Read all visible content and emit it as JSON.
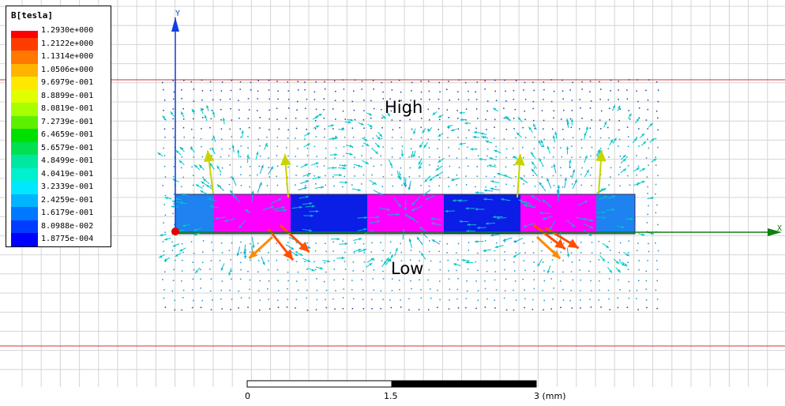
{
  "legend": {
    "title": "B[tesla]",
    "entries": [
      {
        "label": "1.2930e+000",
        "color": "#ff0000"
      },
      {
        "label": "1.2122e+000",
        "color": "#ff3c00"
      },
      {
        "label": "1.1314e+000",
        "color": "#ff7800"
      },
      {
        "label": "1.0506e+000",
        "color": "#ffb400"
      },
      {
        "label": "9.6979e-001",
        "color": "#ffe800"
      },
      {
        "label": "8.8899e-001",
        "color": "#e0ff00"
      },
      {
        "label": "8.0819e-001",
        "color": "#a8ff00"
      },
      {
        "label": "7.2739e-001",
        "color": "#5cf000"
      },
      {
        "label": "6.4659e-001",
        "color": "#00e000"
      },
      {
        "label": "5.6579e-001",
        "color": "#00e050"
      },
      {
        "label": "4.8499e-001",
        "color": "#00e8a0"
      },
      {
        "label": "4.0419e-001",
        "color": "#00f0d0"
      },
      {
        "label": "3.2339e-001",
        "color": "#00e8ff"
      },
      {
        "label": "2.4259e-001",
        "color": "#00b4ff"
      },
      {
        "label": "1.6179e-001",
        "color": "#0078ff"
      },
      {
        "label": "8.0988e-002",
        "color": "#003cff"
      },
      {
        "label": "1.8775e-004",
        "color": "#0000ff"
      }
    ]
  },
  "labels": {
    "high": "High",
    "low": "Low"
  },
  "axes": {
    "y": "Y",
    "x": "X"
  },
  "scale_bar": {
    "ticks": [
      "0",
      "1.5",
      "3 (mm)"
    ]
  },
  "colors": {
    "grid": "#d4d4d4",
    "boundary": "#e04040",
    "axis_y": "#1040e0",
    "axis_x": "#108010",
    "magnet_magenta": "#ff00ff",
    "magnet_blue": "#0a1ee6",
    "magnet_cyan": "#1e82f0",
    "origin": "#e00000"
  }
}
